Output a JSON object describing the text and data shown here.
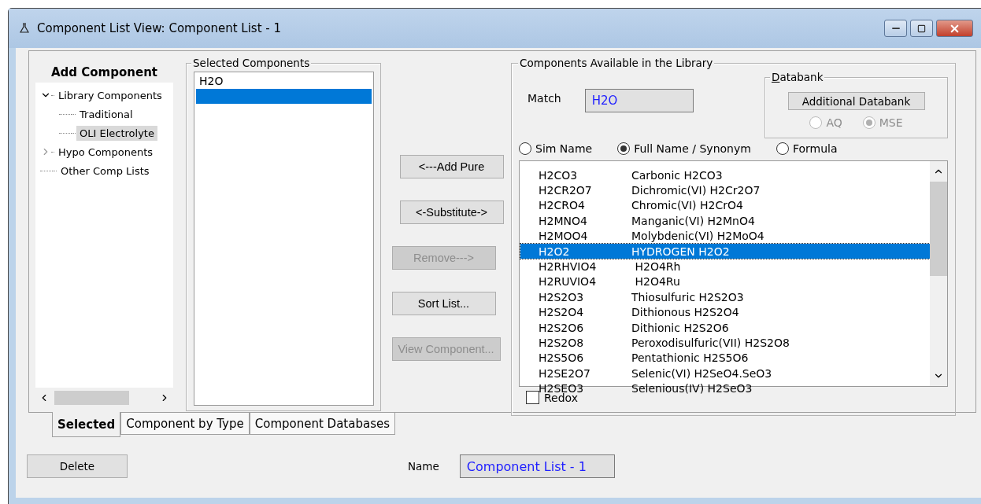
{
  "window": {
    "title": "Component List View: Component List - 1"
  },
  "tree": {
    "heading": "Add Component",
    "items": [
      {
        "label": "Library Components",
        "expanded": true,
        "selected": false,
        "children": [
          {
            "label": "Traditional",
            "selected": false
          },
          {
            "label": "OLI Electrolyte",
            "selected": true
          }
        ]
      },
      {
        "label": "Hypo Components",
        "expanded": false,
        "selected": false
      },
      {
        "label": "Other Comp Lists",
        "selected": false
      }
    ]
  },
  "selected_components": {
    "title": "Selected Components",
    "items": [
      {
        "label": "H2O",
        "selected": false
      }
    ],
    "blank_row_selected": true
  },
  "actions": [
    {
      "label": "<---Add Pure",
      "disabled": false
    },
    {
      "label": "<-Substitute->",
      "disabled": false
    },
    {
      "label": "Remove--->",
      "disabled": true
    },
    {
      "label": "Sort List...",
      "disabled": false
    },
    {
      "label": "View Component...",
      "disabled": true
    }
  ],
  "library": {
    "title": "Components Available in the Library",
    "match_label": "Match",
    "match_value": "H2O",
    "databank": {
      "title": "Databank",
      "button": "Additional Databank",
      "options": [
        {
          "label": "AQ",
          "selected": false,
          "disabled": true
        },
        {
          "label": "MSE",
          "selected": true,
          "disabled": true
        }
      ]
    },
    "modes": [
      {
        "label": "Sim Name",
        "selected": false
      },
      {
        "label": "Full Name / Synonym",
        "selected": true
      },
      {
        "label": "Formula",
        "selected": false
      }
    ],
    "rows": [
      {
        "code": "H2CO3",
        "name": "Carbonic H2CO3",
        "selected": false
      },
      {
        "code": "H2CR2O7",
        "name": "Dichromic(VI) H2Cr2O7",
        "selected": false
      },
      {
        "code": "H2CRO4",
        "name": "Chromic(VI) H2CrO4",
        "selected": false
      },
      {
        "code": "H2MNO4",
        "name": "Manganic(VI) H2MnO4",
        "selected": false
      },
      {
        "code": "H2MOO4",
        "name": "Molybdenic(VI) H2MoO4",
        "selected": false
      },
      {
        "code": "H2O2",
        "name": "HYDROGEN H2O2",
        "selected": true
      },
      {
        "code": "H2RHVIO4",
        "name": " H2O4Rh",
        "selected": false
      },
      {
        "code": "H2RUVIO4",
        "name": " H2O4Ru",
        "selected": false
      },
      {
        "code": "H2S2O3",
        "name": "Thiosulfuric H2S2O3",
        "selected": false
      },
      {
        "code": "H2S2O4",
        "name": "Dithionous H2S2O4",
        "selected": false
      },
      {
        "code": "H2S2O6",
        "name": "Dithionic H2S2O6",
        "selected": false
      },
      {
        "code": "H2S2O8",
        "name": "Peroxodisulfuric(VII) H2S2O8",
        "selected": false
      },
      {
        "code": "H2S5O6",
        "name": "Pentathionic H2S5O6",
        "selected": false
      },
      {
        "code": "H2SE2O7",
        "name": "Selenic(VI) H2SeO4.SeO3",
        "selected": false
      },
      {
        "code": "H2SEO3",
        "name": "Selenious(IV) H2SeO3",
        "selected": false
      }
    ],
    "redox": {
      "label": "Redox",
      "checked": false
    }
  },
  "tabs": [
    {
      "label": "Selected",
      "selected": true
    },
    {
      "label": "Component by Type",
      "selected": false
    },
    {
      "label": "Component Databases",
      "selected": false
    }
  ],
  "delete_button": "Delete",
  "name_field": {
    "label": "Name",
    "value": "Component List - 1"
  }
}
